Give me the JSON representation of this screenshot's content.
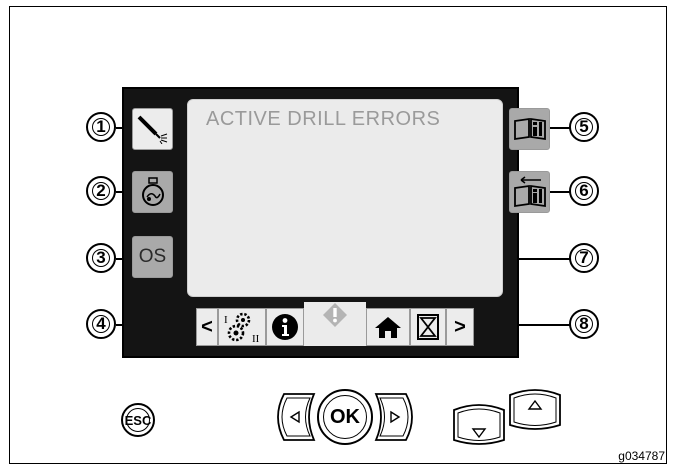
{
  "screen": {
    "title": "ACTIVE DRILL ERRORS",
    "left_buttons": [
      {
        "icon": "spray-nozzle-icon"
      },
      {
        "icon": "engine-icon"
      },
      {
        "label": "OS"
      }
    ],
    "right_buttons": [
      {
        "icon": "book-info-icon"
      },
      {
        "icon": "book-return-icon"
      }
    ],
    "tabs": {
      "prev": "<",
      "settings_icon": "gears-icon",
      "info": "i",
      "alert_icon": "warning-icon",
      "home_icon": "home-icon",
      "hourglass_icon": "hourglass-icon",
      "next": ">"
    }
  },
  "callouts": [
    "1",
    "2",
    "3",
    "4",
    "5",
    "6",
    "7",
    "8"
  ],
  "keys": {
    "esc": "ESC",
    "ok": "OK"
  },
  "figure_code": "g034787"
}
